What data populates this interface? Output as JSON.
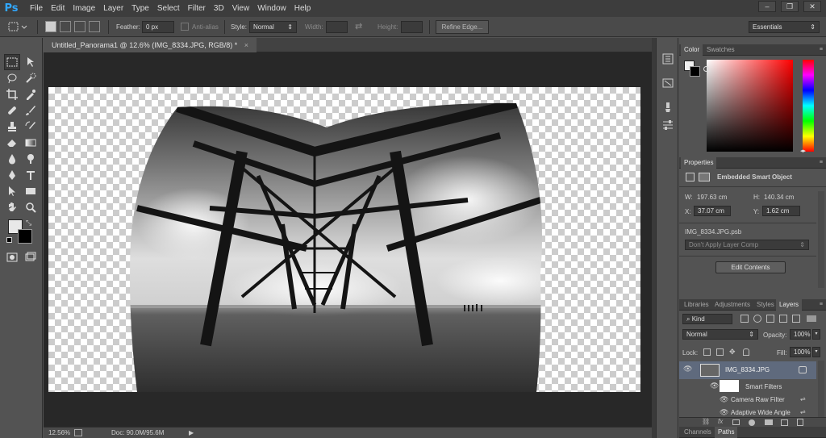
{
  "app": {
    "logo": "Ps"
  },
  "menu": [
    "File",
    "Edit",
    "Image",
    "Layer",
    "Type",
    "Select",
    "Filter",
    "3D",
    "View",
    "Window",
    "Help"
  ],
  "window_controls": [
    "–",
    "❐",
    "✕"
  ],
  "options": {
    "feather_label": "Feather:",
    "feather_value": "0 px",
    "antialias_label": "Anti-alias",
    "style_label": "Style:",
    "style_value": "Normal",
    "width_label": "Width:",
    "height_label": "Height:",
    "refine_edge": "Refine Edge...",
    "workspace": "Essentials"
  },
  "document": {
    "tab_title": "Untitled_Panorama1 @ 12.6% (IMG_8334.JPG, RGB/8) *",
    "close": "×"
  },
  "status": {
    "zoom": "12.56%",
    "doc_label": "Doc: 90.0M/95.6M",
    "arrow": "▶"
  },
  "color_panel": {
    "tabs": [
      "Color",
      "Swatches"
    ],
    "menu": "≡"
  },
  "properties": {
    "title": "Properties",
    "type": "Embedded Smart Object",
    "w_label": "W:",
    "w_value": "197.63 cm",
    "h_label": "H:",
    "h_value": "140.34 cm",
    "x_label": "X:",
    "x_value": "37.07 cm",
    "y_label": "Y:",
    "y_value": "1.62 cm",
    "linked_file": "IMG_8334.JPG.psb",
    "layer_comp": "Don't Apply Layer Comp",
    "edit_button": "Edit Contents"
  },
  "layers_panel": {
    "tabs": [
      "Libraries",
      "Adjustments",
      "Styles",
      "Layers"
    ],
    "kind": "Kind",
    "blend_mode": "Normal",
    "opacity_label": "Opacity:",
    "opacity_value": "100%",
    "lock_label": "Lock:",
    "fill_label": "Fill:",
    "fill_value": "100%",
    "layers": [
      {
        "name": "IMG_8334.JPG"
      },
      {
        "name": "Smart Filters"
      },
      {
        "name": "Camera Raw Filter"
      },
      {
        "name": "Adaptive Wide Angle"
      }
    ]
  },
  "bottom_tabs": [
    "Channels",
    "Paths"
  ]
}
